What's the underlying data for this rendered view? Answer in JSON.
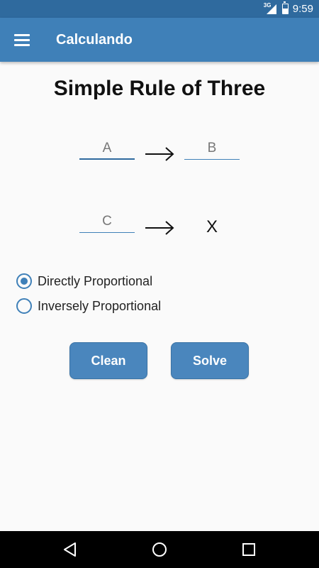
{
  "status_bar": {
    "network": "3G",
    "time": "9:59"
  },
  "app_bar": {
    "title": "Calculando",
    "menu_icon": "hamburger-menu-icon"
  },
  "main": {
    "title": "Simple Rule of Three",
    "fields": {
      "a": {
        "placeholder": "A",
        "value": ""
      },
      "b": {
        "placeholder": "B",
        "value": ""
      },
      "c": {
        "placeholder": "C",
        "value": ""
      }
    },
    "result_label": "X",
    "options": [
      {
        "label": "Directly Proportional",
        "checked": true
      },
      {
        "label": "Inversely Proportional",
        "checked": false
      }
    ],
    "buttons": {
      "clean": "Clean",
      "solve": "Solve"
    }
  },
  "colors": {
    "status_bar": "#2f6a9e",
    "app_bar": "#3f80b8",
    "button": "#4a86bd",
    "background": "#fafafa"
  },
  "nav_bar": {
    "icons": [
      "back-icon",
      "home-icon",
      "recents-icon"
    ]
  }
}
